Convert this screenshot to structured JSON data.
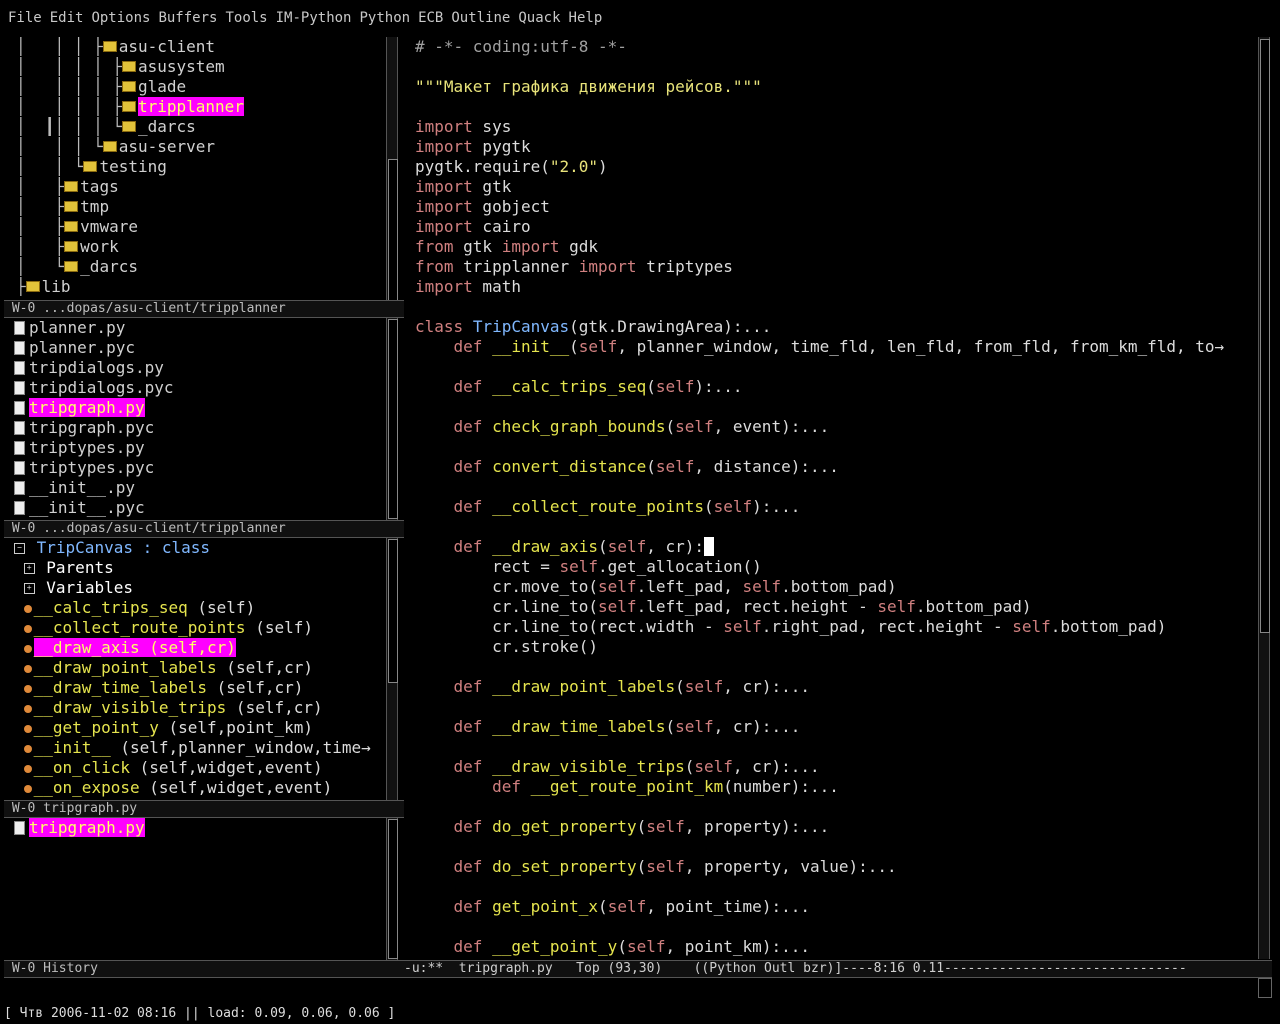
{
  "menubar": [
    "File",
    "Edit",
    "Options",
    "Buffers",
    "Tools",
    "IM-Python",
    "Python",
    "ECB",
    "Outline",
    "Quack",
    "Help"
  ],
  "dirs": {
    "items": [
      {
        "prefix": "│   │ │ ├",
        "name": "asu-client",
        "hl": false
      },
      {
        "prefix": "│   │ │ │ ├",
        "name": "asusystem",
        "hl": false
      },
      {
        "prefix": "│   │ │ │ ├",
        "name": "glade",
        "hl": false
      },
      {
        "prefix": "│   │ │ │ ├",
        "name": "tripplanner",
        "hl": true
      },
      {
        "prefix": "│  ┃│ │ │ └",
        "name": "_darcs",
        "hl": false
      },
      {
        "prefix": "│   │ │ └",
        "name": "asu-server",
        "hl": false
      },
      {
        "prefix": "│   │ └",
        "name": "testing",
        "hl": false
      },
      {
        "prefix": "│   ├",
        "name": "tags",
        "hl": false
      },
      {
        "prefix": "│   ├",
        "name": "tmp",
        "hl": false
      },
      {
        "prefix": "│   ├",
        "name": "vmware",
        "hl": false
      },
      {
        "prefix": "│   ├",
        "name": "work",
        "hl": false
      },
      {
        "prefix": "│   └",
        "name": "_darcs",
        "hl": false
      },
      {
        "prefix": "├",
        "name": "lib",
        "hl": false
      }
    ],
    "modeline": " W-0 ...dopas/asu-client/tripplanner"
  },
  "sources": {
    "items": [
      {
        "name": "planner.py",
        "hl": false
      },
      {
        "name": "planner.pyc",
        "hl": false
      },
      {
        "name": "tripdialogs.py",
        "hl": false
      },
      {
        "name": "tripdialogs.pyc",
        "hl": false
      },
      {
        "name": "tripgraph.py",
        "hl": true
      },
      {
        "name": "tripgraph.pyc",
        "hl": false
      },
      {
        "name": "triptypes.py",
        "hl": false
      },
      {
        "name": "triptypes.pyc",
        "hl": false
      },
      {
        "name": "__init__.py",
        "hl": false
      },
      {
        "name": "__init__.pyc",
        "hl": false
      }
    ],
    "modeline": " W-0 ...dopas/asu-client/tripplanner"
  },
  "methods": {
    "class_line": {
      "name": "TripCanvas",
      "suffix": " : class"
    },
    "groups": [
      "Parents",
      "Variables"
    ],
    "items": [
      {
        "name": "__calc_trips_seq",
        "args": " (self)",
        "hl": false
      },
      {
        "name": "__collect_route_points",
        "args": " (self)",
        "hl": false
      },
      {
        "name": "__draw_axis",
        "args": " (self,cr)",
        "hl": true
      },
      {
        "name": "__draw_point_labels",
        "args": " (self,cr)",
        "hl": false
      },
      {
        "name": "__draw_time_labels",
        "args": " (self,cr)",
        "hl": false
      },
      {
        "name": "__draw_visible_trips",
        "args": " (self,cr)",
        "hl": false
      },
      {
        "name": "__get_point_y",
        "args": " (self,point_km)",
        "hl": false
      },
      {
        "name": "__init__",
        "args": " (self,planner_window,time→",
        "hl": false
      },
      {
        "name": "__on_click",
        "args": " (self,widget,event)",
        "hl": false
      },
      {
        "name": "__on_expose",
        "args": " (self,widget,event)",
        "hl": false
      }
    ],
    "modeline": " W-0 tripgraph.py"
  },
  "history": {
    "items": [
      {
        "name": "tripgraph.py",
        "hl": true
      }
    ],
    "modeline": " W-0 History"
  },
  "editor": {
    "modeline": "-u:**  tripgraph.py   Top (93,30)    ((Python Outl bzr)]----8:16 0.11-------------------------------"
  },
  "echo": "[ Чтв 2006-11-02 08:16 || load: 0.09, 0.06, 0.06 ]",
  "colors": {
    "highlight": "#ff00ff",
    "keyword": "#d08080",
    "function": "#e5e44e",
    "class": "#80b8ff"
  }
}
